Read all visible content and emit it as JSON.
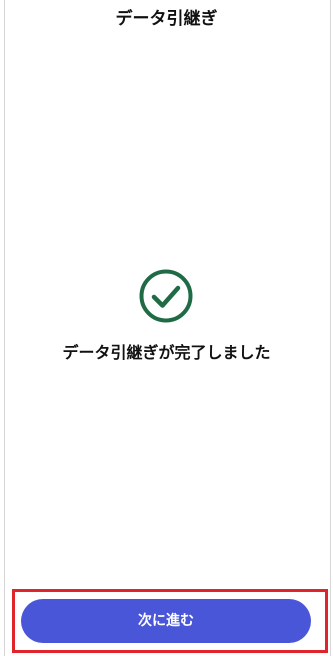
{
  "header": {
    "title": "データ引継ぎ"
  },
  "status": {
    "icon": "check-circle-icon",
    "color": "#1f6b45",
    "message": "データ引継ぎが完了しました"
  },
  "footer": {
    "next_label": "次に進む",
    "button_color": "#4a56d8",
    "highlight_color": "#e0242b"
  }
}
